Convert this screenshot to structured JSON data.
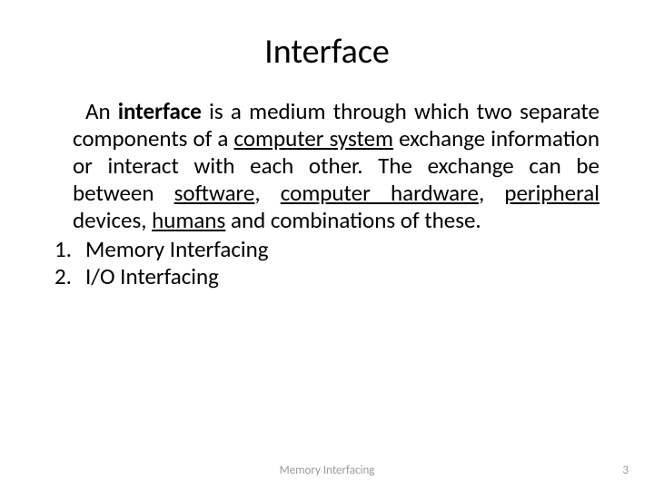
{
  "title": "Interface",
  "paragraph": {
    "part1": "An ",
    "bold1": "interface",
    "part2": " is a medium through which two separate components of a ",
    "link1": "computer system",
    "part3": " exchange information or interact with each other. The exchange can be between ",
    "link2": "software",
    "part4": ", ",
    "link3": "computer hardware",
    "part5": ", ",
    "link4": "peripheral",
    "part6": " devices, ",
    "link5": "humans",
    "part7": " and combinations of these."
  },
  "list": [
    {
      "num": "1.",
      "text": "Memory Interfacing"
    },
    {
      "num": "2.",
      "text": "I/O Interfacing"
    }
  ],
  "footer": "Memory Interfacing",
  "page": "3"
}
